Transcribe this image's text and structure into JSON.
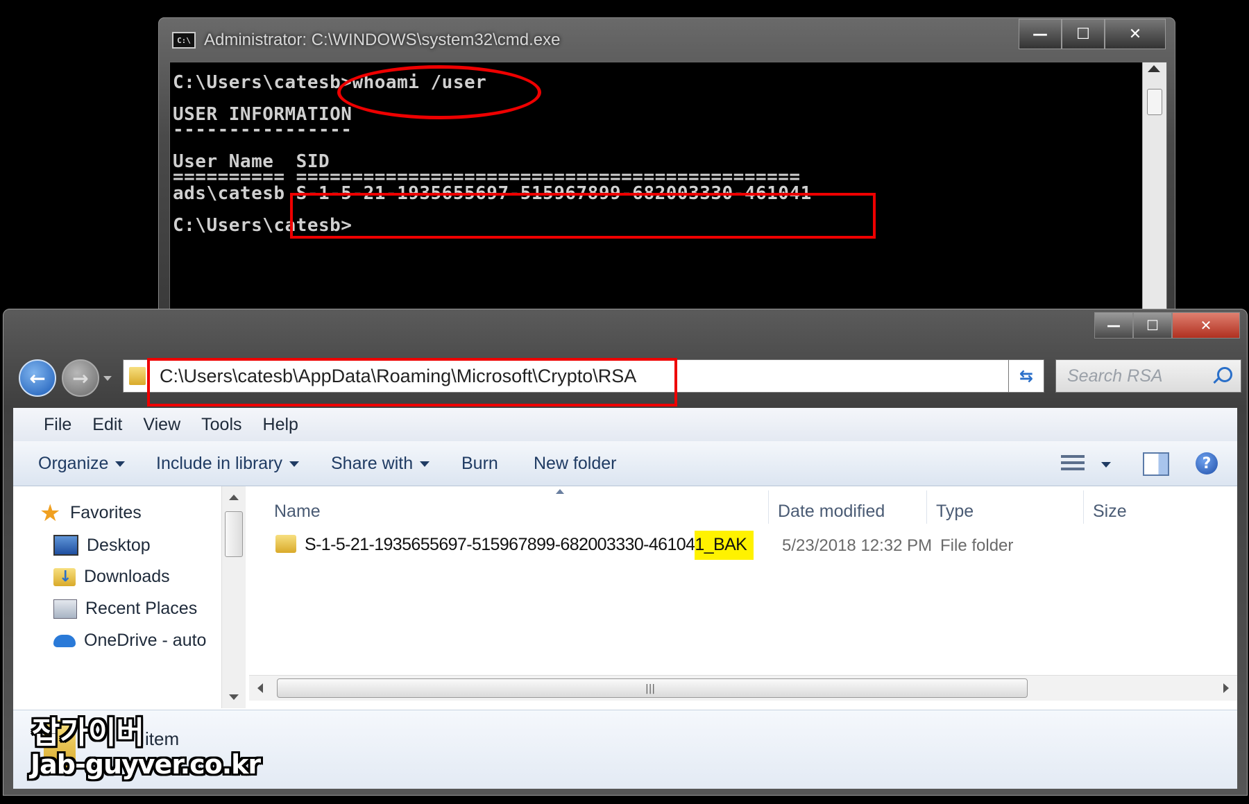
{
  "cmd": {
    "title": "Administrator: C:\\WINDOWS\\system32\\cmd.exe",
    "icon_text": "C:\\",
    "controls": {
      "minimize": "—",
      "maximize": "☐",
      "close": "✕"
    },
    "lines": [
      "C:\\Users\\catesb>whoami /user",
      "USER INFORMATION",
      "----------------",
      "User Name  SID",
      "========== =============================================",
      "ads\\catesb S-1-5-21-1935655697-515967899-682003330-461041",
      "C:\\Users\\catesb>"
    ]
  },
  "explorer": {
    "controls": {
      "minimize": "—",
      "maximize": "☐",
      "close": "✕"
    },
    "nav": {
      "back": "←",
      "forward": "→"
    },
    "address": "C:\\Users\\catesb\\AppData\\Roaming\\Microsoft\\Crypto\\RSA",
    "refresh": "⇆",
    "search_placeholder": "Search RSA",
    "menu": [
      "File",
      "Edit",
      "View",
      "Tools",
      "Help"
    ],
    "commands": [
      "Organize",
      "Include in library",
      "Share with",
      "Burn",
      "New folder"
    ],
    "help": "?",
    "nav_pane": {
      "favorites": "Favorites",
      "items": [
        "Desktop",
        "Downloads",
        "Recent Places",
        "OneDrive - auto"
      ]
    },
    "columns": [
      "Name",
      "Date modified",
      "Type",
      "Size"
    ],
    "file": {
      "name_main": "S-1-5-21-1935655697-515967899-682003330-46104",
      "name_highlight": "1_BAK",
      "date": "5/23/2018 12:32 PM",
      "type": "File folder"
    },
    "scroll_grip": "|||",
    "status_count": "item"
  },
  "watermark": {
    "line1": "잡가이버",
    "line2": "Jab-guyver.co.kr"
  },
  "colors": {
    "annotation_red": "#e00000",
    "highlight_yellow": "#fff200"
  }
}
